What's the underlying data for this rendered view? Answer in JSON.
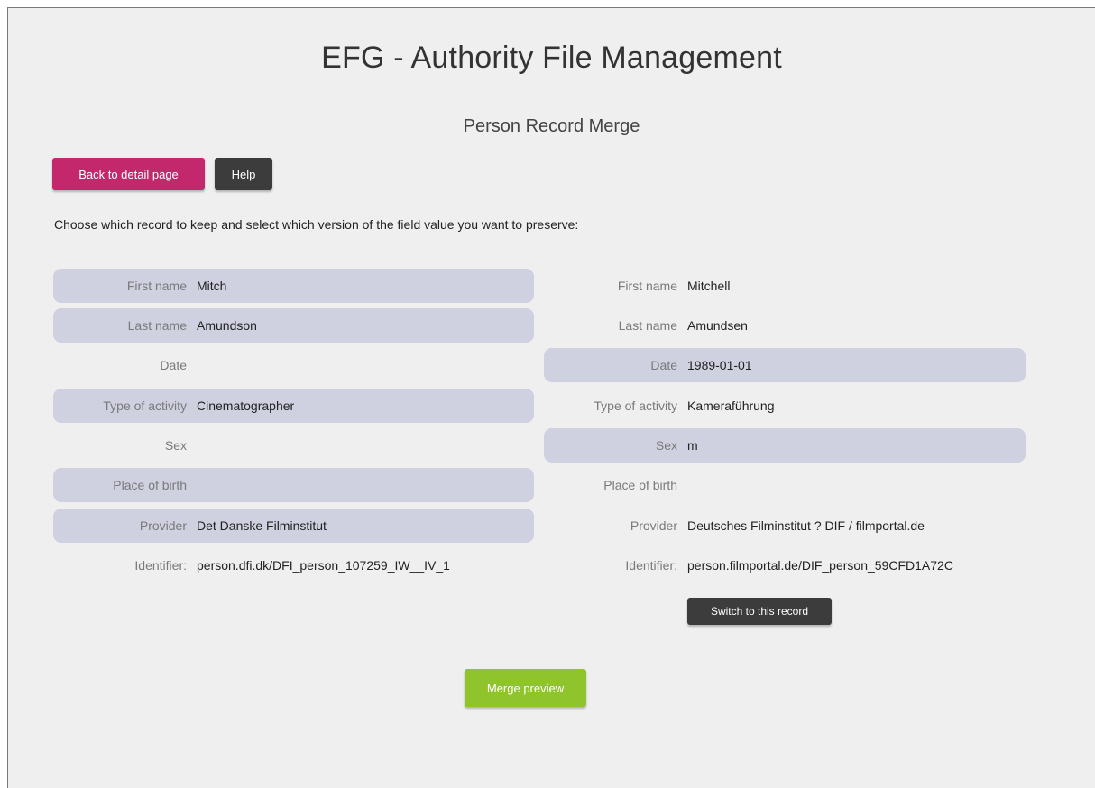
{
  "header": {
    "title": "EFG - Authority File Management",
    "subtitle": "Person Record Merge"
  },
  "toolbar": {
    "back_label": "Back to detail page",
    "help_label": "Help"
  },
  "instructions": "Choose which record to keep and select which version of the field value you want to preserve:",
  "left_record": {
    "fields": [
      {
        "label": "First name",
        "value": "Mitch",
        "selected": true
      },
      {
        "label": "Last name",
        "value": "Amundson",
        "selected": true
      },
      {
        "label": "Date",
        "value": "",
        "selected": false
      },
      {
        "label": "Type of activity",
        "value": "Cinematographer",
        "selected": true
      },
      {
        "label": "Sex",
        "value": "",
        "selected": false
      },
      {
        "label": "Place of birth",
        "value": "",
        "selected": true
      },
      {
        "label": "Provider",
        "value": "Det Danske Filminstitut",
        "selected": true
      },
      {
        "label": "Identifier:",
        "value": "person.dfi.dk/DFI_person_107259_IW__IV_1",
        "selected": false
      }
    ]
  },
  "right_record": {
    "fields": [
      {
        "label": "First name",
        "value": "Mitchell",
        "selected": false
      },
      {
        "label": "Last name",
        "value": "Amundsen",
        "selected": false
      },
      {
        "label": "Date",
        "value": "1989-01-01",
        "selected": true
      },
      {
        "label": "Type of activity",
        "value": "Kameraführung",
        "selected": false
      },
      {
        "label": "Sex",
        "value": "m",
        "selected": true
      },
      {
        "label": "Place of birth",
        "value": "",
        "selected": false
      },
      {
        "label": "Provider",
        "value": "Deutsches Filminstitut ? DIF / filmportal.de",
        "selected": false
      },
      {
        "label": "Identifier:",
        "value": "person.filmportal.de/DIF_person_59CFD1A72C",
        "selected": false
      }
    ],
    "switch_label": "Switch to this record"
  },
  "actions": {
    "merge_preview_label": "Merge preview"
  },
  "colors": {
    "back_button": "#c2286b",
    "dark_button": "#3c3c3c",
    "merge_button": "#8fc42c",
    "selected_row": "#cfd0e0"
  }
}
